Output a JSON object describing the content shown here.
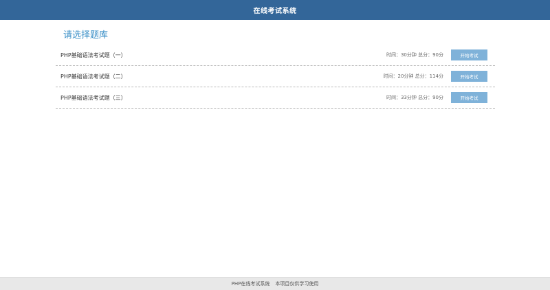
{
  "header": {
    "title": "在线考试系统"
  },
  "main": {
    "section_title": "请选择题库",
    "exams": [
      {
        "name": "PHP基础语法考试题（一）",
        "meta": "时间：30分钟 总分：90分",
        "button_label": "开始考试"
      },
      {
        "name": "PHP基础语法考试题（二）",
        "meta": "时间：20分钟 总分：114分",
        "button_label": "开始考试"
      },
      {
        "name": "PHP基础语法考试题（三）",
        "meta": "时间：33分钟 总分：90分",
        "button_label": "开始考试"
      }
    ]
  },
  "footer": {
    "system_name": "PHP在线考试系统",
    "notice": "本项目仅供学习使用"
  },
  "colors": {
    "header_bg": "#336699",
    "title_accent": "#3a8fc7",
    "button_bg": "#7fb2d9",
    "footer_bg": "#e8e8e8"
  }
}
